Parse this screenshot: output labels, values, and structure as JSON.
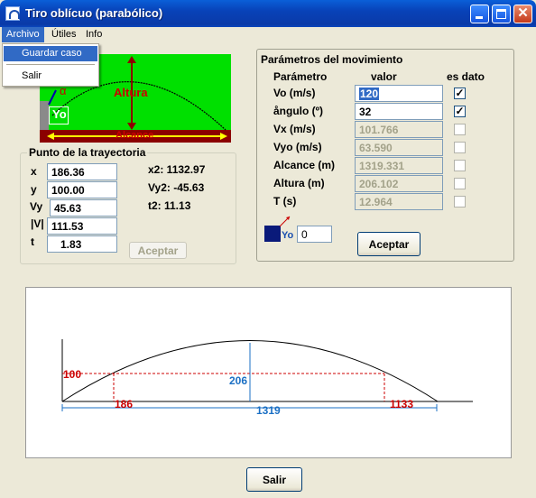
{
  "window": {
    "title": "Tiro oblícuo (parabólico)"
  },
  "menu": {
    "items": [
      "Archivo",
      "Útiles",
      "Info"
    ],
    "dropdown": {
      "item1": "Guardar caso",
      "item2": "Salir"
    }
  },
  "diagram": {
    "label_height": "Altura",
    "label_range": "Alcance",
    "label_angle": "α",
    "label_y0": "Yo"
  },
  "trajectory_point": {
    "title": "Punto de la trayectoria",
    "x_label": "x",
    "x_value": "186.36",
    "y_label": "y",
    "y_value": "100.00",
    "vy_label": "Vy",
    "vy_value": "45.63",
    "v_label": "|V|",
    "v_value": "111.53",
    "t_label": "t",
    "t_value": "1.83",
    "x2": "x2: 1132.97",
    "vy2": "Vy2: -45.63",
    "t2": "t2:  11.13",
    "accept_label": "Aceptar"
  },
  "parameters": {
    "title": "Parámetros del movimiento",
    "col_param": "Parámetro",
    "col_value": "valor",
    "col_data": "es dato",
    "rows": [
      {
        "label": "Vo (m/s)",
        "value": "120",
        "is_data": true,
        "enabled": true
      },
      {
        "label": "ångulo (º)",
        "value": "32",
        "is_data": true,
        "enabled": true
      },
      {
        "label": "Vx (m/s)",
        "value": "101.766",
        "is_data": false,
        "enabled": false
      },
      {
        "label": "Vyo (m/s)",
        "value": "63.590",
        "is_data": false,
        "enabled": false
      },
      {
        "label": "Alcance (m)",
        "value": "1319.331",
        "is_data": false,
        "enabled": false
      },
      {
        "label": "Altura (m)",
        "value": "206.102",
        "is_data": false,
        "enabled": false
      },
      {
        "label": "T (s)",
        "value": "12.964",
        "is_data": false,
        "enabled": false
      }
    ],
    "y0_icon_label": "Yo",
    "y0_value": "0",
    "accept_label": "Aceptar"
  },
  "plot": {
    "y_point": "100",
    "height": "206",
    "x1": "186",
    "range": "1319",
    "x2": "1133"
  },
  "footer": {
    "exit_label": "Salir"
  },
  "colors": {
    "title_bar": "#0842b8",
    "selection": "#316ac5",
    "accent_red": "#cc0000",
    "accent_blue": "#1a6fc4",
    "diagram_green": "#00e000"
  }
}
